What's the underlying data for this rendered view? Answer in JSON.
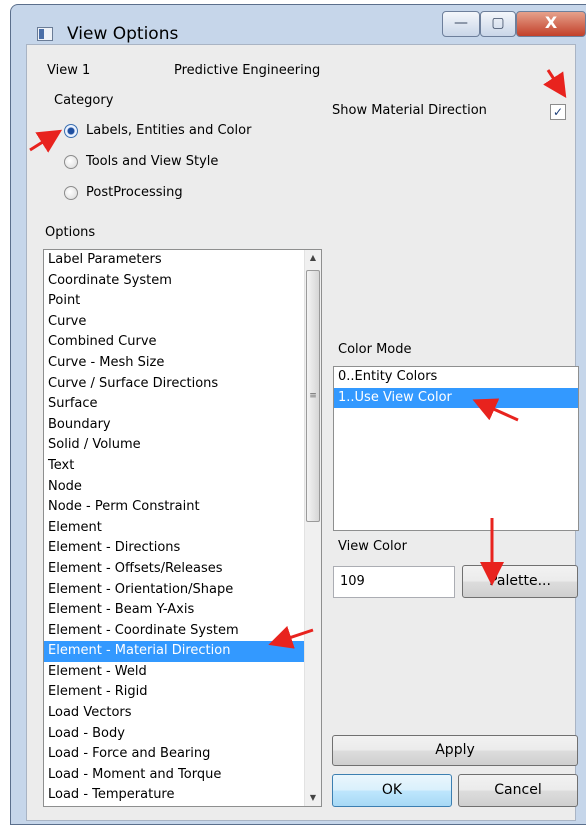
{
  "window": {
    "title": "View Options",
    "controls": {
      "minimize": "—",
      "maximize": "▢",
      "close": "X"
    }
  },
  "header": {
    "view_label": "View 1",
    "view_name": "Predictive Engineering"
  },
  "category": {
    "label": "Category",
    "options": [
      {
        "label": "Labels, Entities and Color",
        "checked": true
      },
      {
        "label": "Tools and View Style",
        "checked": false
      },
      {
        "label": "PostProcessing",
        "checked": false
      }
    ]
  },
  "options": {
    "label": "Options",
    "items": [
      "Label Parameters",
      "Coordinate System",
      "Point",
      "Curve",
      "Combined Curve",
      "Curve - Mesh Size",
      "Curve / Surface Directions",
      "Surface",
      "Boundary",
      "Solid / Volume",
      "Text",
      "Node",
      "Node - Perm Constraint",
      "Element",
      "Element - Directions",
      "Element - Offsets/Releases",
      "Element - Orientation/Shape",
      "Element - Beam Y-Axis",
      "Element - Coordinate System",
      "Element - Material Direction",
      "Element - Weld",
      "Element - Rigid",
      "Load Vectors",
      "Load - Body",
      "Load - Force and Bearing",
      "Load - Moment and Torque",
      "Load - Temperature"
    ],
    "selected_index": 19
  },
  "show_material_direction": {
    "label": "Show Material Direction",
    "checked": true,
    "mark": "✓"
  },
  "color_mode": {
    "label": "Color Mode",
    "items": [
      "0..Entity Colors",
      "1..Use View Color"
    ],
    "selected_index": 1
  },
  "view_color": {
    "label": "View Color",
    "value": "109",
    "palette_button": "Palette..."
  },
  "buttons": {
    "apply": "Apply",
    "ok": "OK",
    "cancel": "Cancel"
  },
  "icons": {
    "scroll_up": "▲",
    "scroll_down": "▼",
    "grip": "≡"
  },
  "colors": {
    "selection": "#3399ff",
    "annotation_arrow": "#e8231e",
    "window_frame": "#c6d6ea"
  }
}
